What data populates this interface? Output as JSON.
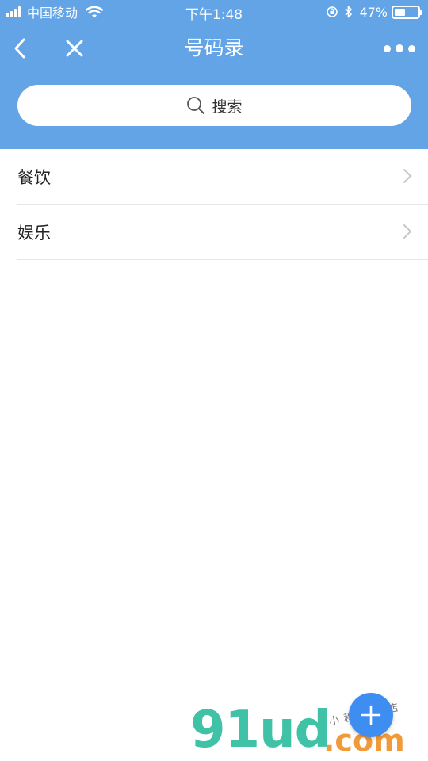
{
  "status_bar": {
    "carrier": "中国移动",
    "time": "下午1:48",
    "battery_percent": "47%",
    "battery_level": 0.47,
    "icons": [
      "signal-icon",
      "wifi-icon",
      "orientation-lock-icon",
      "bluetooth-icon",
      "battery-icon"
    ]
  },
  "navbar": {
    "title": "号码录",
    "icons": [
      "back-icon",
      "close-icon",
      "more-icon"
    ]
  },
  "search": {
    "placeholder": "搜索",
    "icon": "search-icon"
  },
  "list": {
    "items": [
      {
        "label": "餐饮"
      },
      {
        "label": "娱乐"
      }
    ]
  },
  "fab": {
    "icon": "plus-icon"
  },
  "watermark": {
    "logo": "91ud",
    "domain": ".com",
    "subtitle": "小程序商店"
  },
  "colors": {
    "header": "#62a4e5",
    "fab": "#3e8ef2",
    "divider": "#e6e6e6",
    "watermark_green": "#3fc2a6",
    "watermark_orange": "#f19a3a"
  }
}
